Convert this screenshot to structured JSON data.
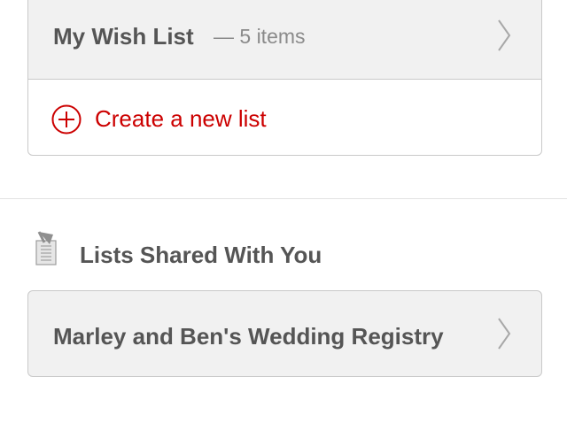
{
  "lists": {
    "wish_list": {
      "title": "My Wish List",
      "count": "— 5 items"
    },
    "create": {
      "label": "Create a new list"
    }
  },
  "shared": {
    "heading": "Lists Shared With You",
    "items": [
      {
        "name": "Marley and Ben's Wedding Registry"
      }
    ]
  },
  "icons": {
    "chevron": "chevron-right-icon",
    "plus": "plus-circle-icon",
    "shared": "shared-document-icon"
  },
  "colors": {
    "accent": "#cc0000",
    "text": "#555555",
    "muted": "#8a8a8a",
    "row_bg": "#f1f1f1",
    "border": "#c9c9c9"
  }
}
